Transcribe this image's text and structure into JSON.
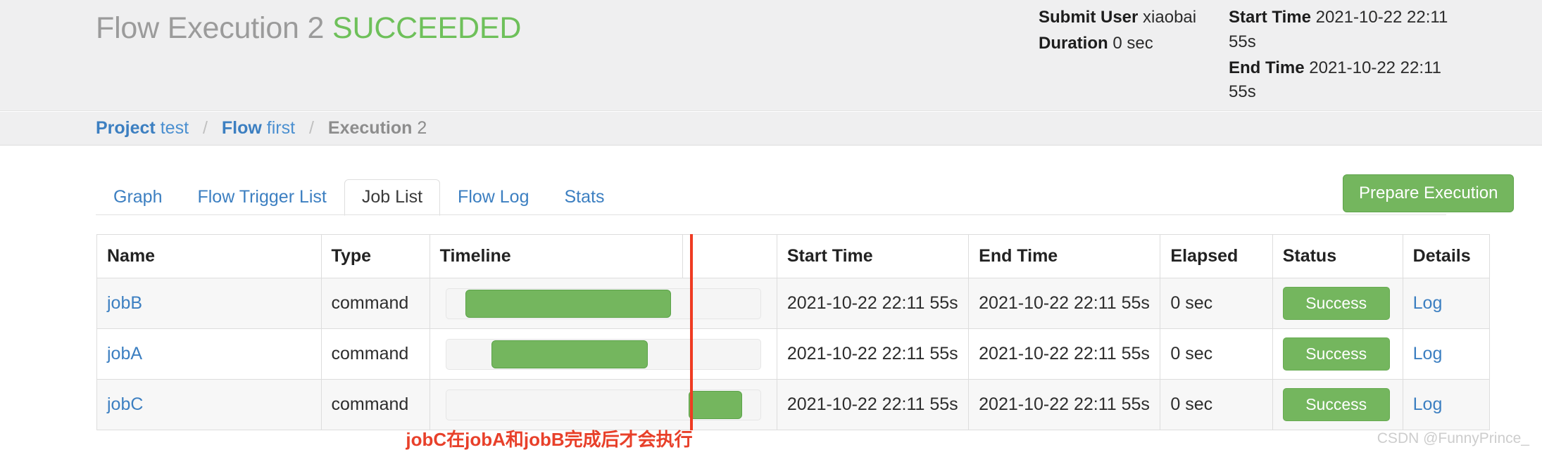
{
  "header": {
    "title_prefix": "Flow Execution",
    "execution_number": "2",
    "status": "SUCCEEDED",
    "status_color": "#6ec05a",
    "meta": {
      "submit_user_label": "Submit User",
      "submit_user_value": "xiaobai",
      "duration_label": "Duration",
      "duration_value": "0 sec",
      "start_time_label": "Start Time",
      "start_time_value": "2021-10-22 22:11 55s",
      "end_time_label": "End Time",
      "end_time_value": "2021-10-22 22:11 55s"
    }
  },
  "breadcrumb": {
    "project_label": "Project",
    "project_value": "test",
    "flow_label": "Flow",
    "flow_value": "first",
    "execution_label": "Execution",
    "execution_value": "2",
    "separator": "/"
  },
  "tabs": [
    {
      "label": "Graph",
      "active": false
    },
    {
      "label": "Flow Trigger List",
      "active": false
    },
    {
      "label": "Job List",
      "active": true
    },
    {
      "label": "Flow Log",
      "active": false
    },
    {
      "label": "Stats",
      "active": false
    }
  ],
  "actions": {
    "prepare_execution_label": "Prepare Execution",
    "prepare_execution_color": "#74b65e"
  },
  "table": {
    "columns": [
      "Name",
      "Type",
      "Timeline",
      "",
      "Start Time",
      "End Time",
      "Elapsed",
      "Status",
      "Details"
    ],
    "rows": [
      {
        "name": "jobB",
        "type": "command",
        "bar_start_pct": 6.1,
        "bar_end_pct": 71.6,
        "start_time": "2021-10-22 22:11 55s",
        "end_time": "2021-10-22 22:11 55s",
        "elapsed": "0 sec",
        "status": "Success",
        "details": "Log"
      },
      {
        "name": "jobA",
        "type": "command",
        "bar_start_pct": 14.4,
        "bar_end_pct": 64.1,
        "start_time": "2021-10-22 22:11 55s",
        "end_time": "2021-10-22 22:11 55s",
        "elapsed": "0 sec",
        "status": "Success",
        "details": "Log"
      },
      {
        "name": "jobC",
        "type": "command",
        "bar_start_pct": 77.2,
        "bar_end_pct": 94.1,
        "start_time": "2021-10-22 22:11 55s",
        "end_time": "2021-10-22 22:11 55s",
        "elapsed": "0 sec",
        "status": "Success",
        "details": "Log"
      }
    ],
    "marker_line_color": "#ef3b22"
  },
  "annotation": {
    "text": "jobC在jobA和jobB完成后才会执行",
    "color": "#e8402a"
  },
  "watermark": {
    "text": "CSDN @FunnyPrince_"
  }
}
